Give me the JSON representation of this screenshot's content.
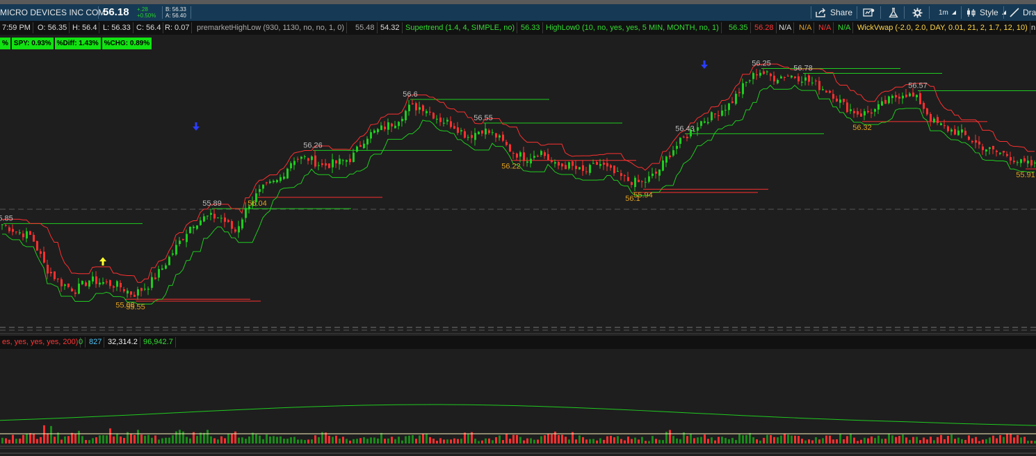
{
  "header": {
    "company": "MICRO DEVICES INC COM",
    "price": "56.18",
    "change": "+.28",
    "change_pct": "+0.50%",
    "bid": "B: 56.33",
    "ask": "A: 56.40",
    "share_label": "Share",
    "interval_label": "1m",
    "style_label": "Style",
    "drawing_label": "Dra"
  },
  "infobar": {
    "time": "7:59 PM",
    "open": "O: 56.35",
    "high": "H: 56.4",
    "low": "L: 56.33",
    "close": "C: 56.4",
    "range": "R: 0.07",
    "study1": "premarketHighLow (930, 1130, no, no, 1, 0)",
    "study1_v1": "55.48",
    "study1_v2": "54.32",
    "study2": "Supertrend (1.4, 4, SIMPLE, no)",
    "study2_v": "56.33",
    "study3": "HighLow0 (10, no, yes, yes, 5 MIN, MONTH, no, 1)",
    "study3_v1": "56.35",
    "study3_v2": "56.28",
    "na1": "N/A",
    "na2": "N/A",
    "na3": "N/A",
    "na4": "N/A",
    "study4": "WickVwap (-2.0, 2.0, DAY, 0.01, 21, 2, 1.7, 12, 10)",
    "tail": "n"
  },
  "badges": [
    "%",
    "SPY: 0.93%",
    "%Diff: 1.43%",
    "%CHG: 0.89%"
  ],
  "volume_bar": {
    "study": "es, yes, yes, yes, 200)",
    "v0": "0",
    "v1": "827",
    "v2": "32,314.2",
    "v3": "96,942.7"
  },
  "colors": {
    "up": "#1fcc1f",
    "down": "#ff3030",
    "high_label": "#bdbdbd",
    "low_label": "#e0a020",
    "header_bg": "#163a55"
  },
  "chart_data": {
    "type": "candlestick",
    "interval": "1m",
    "y_range": [
      55.3,
      57.2
    ],
    "high_labels": [
      {
        "text": "55.85",
        "value": 55.85
      },
      {
        "text": "55.89",
        "value": 55.89
      },
      {
        "text": "56.26",
        "value": 56.26
      },
      {
        "text": "56.6",
        "value": 56.6
      },
      {
        "text": "56.55",
        "value": 56.55
      },
      {
        "text": "56.43",
        "value": 56.43
      },
      {
        "text": "56.25",
        "value": 56.25
      },
      {
        "text": "56.78",
        "value": 56.78
      },
      {
        "text": "56.57",
        "value": 56.57
      }
    ],
    "low_labels": [
      {
        "text": "55.08",
        "value": 55.08
      },
      {
        "text": "55.55",
        "value": 55.55
      },
      {
        "text": "56.04",
        "value": 56.04
      },
      {
        "text": "56.22",
        "value": 56.22
      },
      {
        "text": "56.1",
        "value": 56.1
      },
      {
        "text": "55.94",
        "value": 55.94
      },
      {
        "text": "56.32",
        "value": 56.32
      },
      {
        "text": "55.91",
        "value": 55.91
      }
    ],
    "price_path": [
      56.0,
      55.95,
      55.92,
      55.7,
      55.6,
      55.55,
      55.62,
      55.6,
      55.58,
      55.52,
      55.58,
      55.7,
      55.85,
      56.0,
      56.05,
      56.05,
      55.95,
      56.15,
      56.25,
      56.3,
      56.45,
      56.45,
      56.4,
      56.42,
      56.45,
      56.6,
      56.65,
      56.7,
      56.8,
      56.8,
      56.72,
      56.68,
      56.6,
      56.65,
      56.6,
      56.5,
      56.45,
      56.5,
      56.4,
      56.4,
      56.35,
      56.42,
      56.35,
      56.3,
      56.28,
      56.35,
      56.5,
      56.6,
      56.7,
      56.75,
      56.82,
      56.95,
      57.05,
      57.0,
      57.02,
      57.0,
      56.95,
      56.9,
      56.8,
      56.75,
      56.78,
      56.85,
      56.9,
      56.85,
      56.7,
      56.65,
      56.62,
      56.55,
      56.5,
      56.48,
      56.42,
      56.4
    ],
    "volume_path": [
      4,
      6,
      5,
      8,
      5,
      6,
      4,
      7,
      5,
      9,
      5,
      4,
      6,
      5,
      8,
      4,
      6,
      5,
      4,
      5,
      4,
      3,
      5,
      4,
      3,
      4,
      5,
      3,
      4,
      6,
      3,
      4,
      5,
      3,
      4,
      5,
      3,
      4,
      6,
      5,
      4,
      3,
      5,
      4,
      3,
      4,
      6,
      5,
      4,
      3,
      4,
      5,
      3,
      4,
      5,
      4,
      3,
      4,
      5,
      3,
      4,
      5,
      4,
      3,
      4,
      5,
      4,
      3,
      4,
      5,
      4,
      3
    ]
  }
}
